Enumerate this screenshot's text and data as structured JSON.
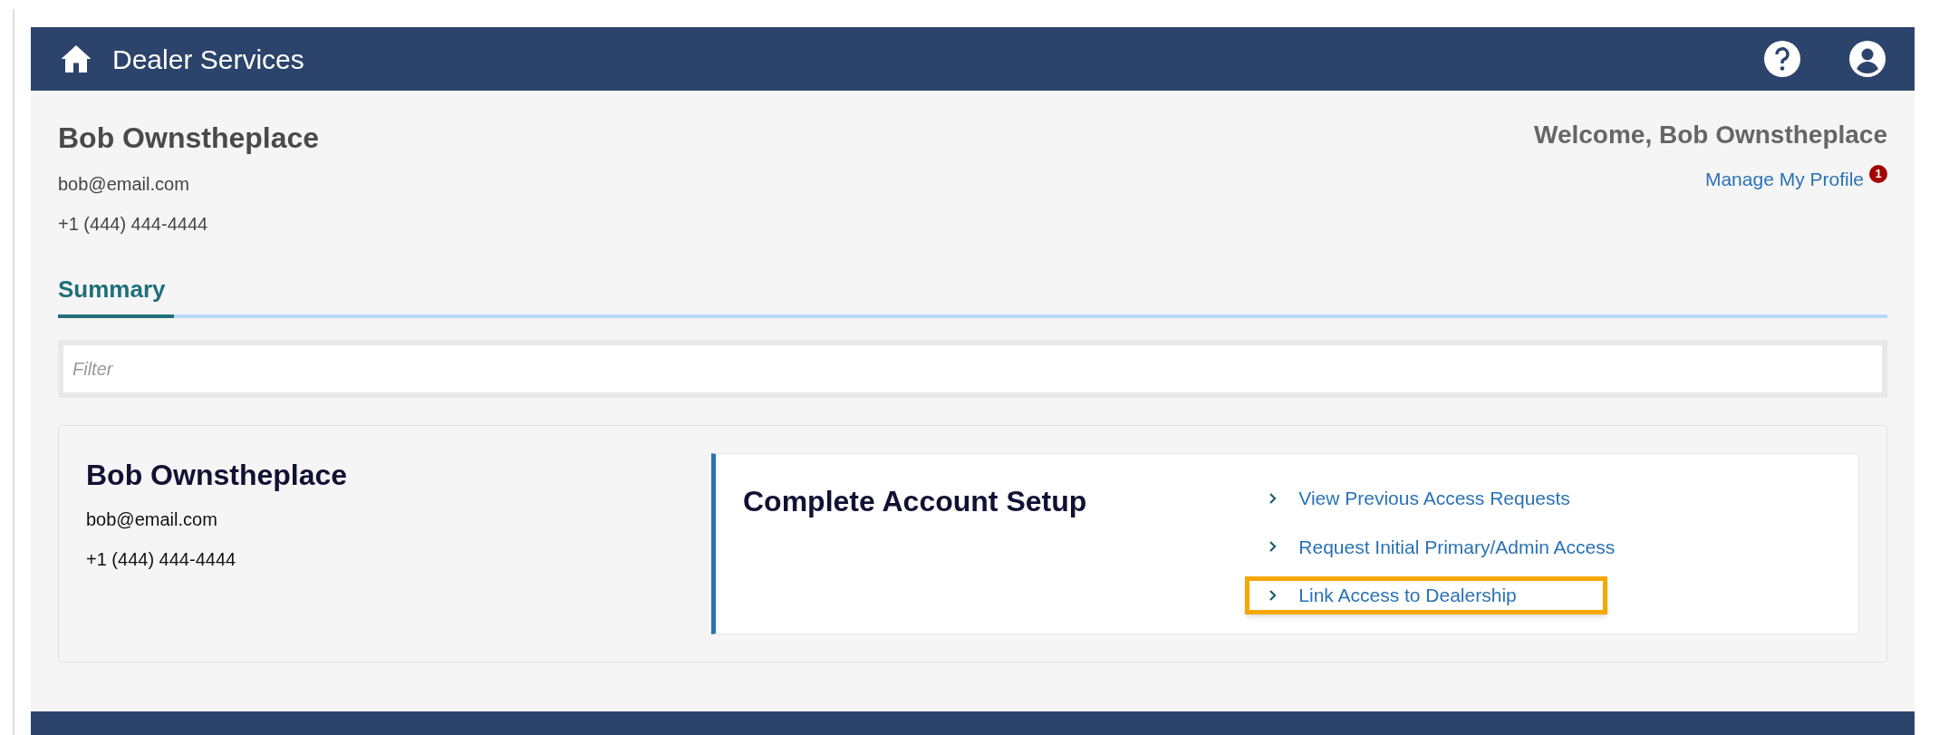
{
  "header": {
    "title": "Dealer Services"
  },
  "profile": {
    "name": "Bob Ownstheplace",
    "email": "bob@email.com",
    "phone": "+1 (444) 444-4444"
  },
  "welcome": {
    "text": "Welcome, Bob Ownstheplace",
    "link": "Manage My Profile",
    "badge": "1"
  },
  "tabs": [
    {
      "label": "Summary",
      "selected": true
    }
  ],
  "filter": {
    "placeholder": "Filter"
  },
  "card": {
    "name": "Bob Ownstheplace",
    "email": "bob@email.com",
    "phone": "+1 (444) 444-4444",
    "panel_title": "Complete Account Setup",
    "links": [
      {
        "label": "View Previous Access Requests",
        "highlighted": false
      },
      {
        "label": "Request Initial Primary/Admin Access",
        "highlighted": false
      },
      {
        "label": "Link Access to Dealership",
        "highlighted": true
      }
    ]
  }
}
